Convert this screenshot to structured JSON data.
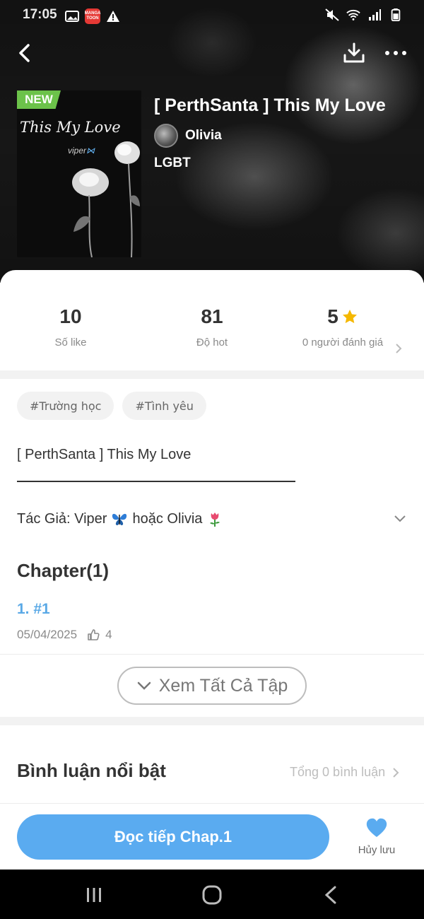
{
  "status_bar": {
    "time": "17:05",
    "app_badge": "MANGA TOON"
  },
  "header": {
    "new_badge": "NEW",
    "cover_title": "This My Love",
    "cover_subtitle": "viper",
    "title": "[ PerthSanta ] This My Love",
    "author": "Olivia",
    "genre": "LGBT"
  },
  "stats": {
    "likes": {
      "value": "10",
      "label": "Số like"
    },
    "hot": {
      "value": "81",
      "label": "Độ hot"
    },
    "rating": {
      "value": "5",
      "label": "0 người đánh giá"
    }
  },
  "tags": [
    "#Trường học",
    "#Tình yêu"
  ],
  "description": {
    "title_line": "[ PerthSanta ] This My Love",
    "author_prefix": "Tác Giả: Viper",
    "author_middle": "hoặc Olivia"
  },
  "chapters": {
    "heading": "Chapter(1)",
    "items": [
      {
        "label": "1. #1",
        "date": "05/04/2025",
        "likes": "4"
      }
    ],
    "view_all_label": "Xem Tất Cả Tập"
  },
  "comments": {
    "heading": "Bình luận nổi bật",
    "total": "Tổng 0 bình luận"
  },
  "bottom_bar": {
    "read_button": "Đọc tiếp Chap.1",
    "save_label": "Hủy lưu"
  },
  "colors": {
    "accent": "#5aabf0",
    "new_badge": "#6cc24a",
    "star": "#f5b800"
  }
}
